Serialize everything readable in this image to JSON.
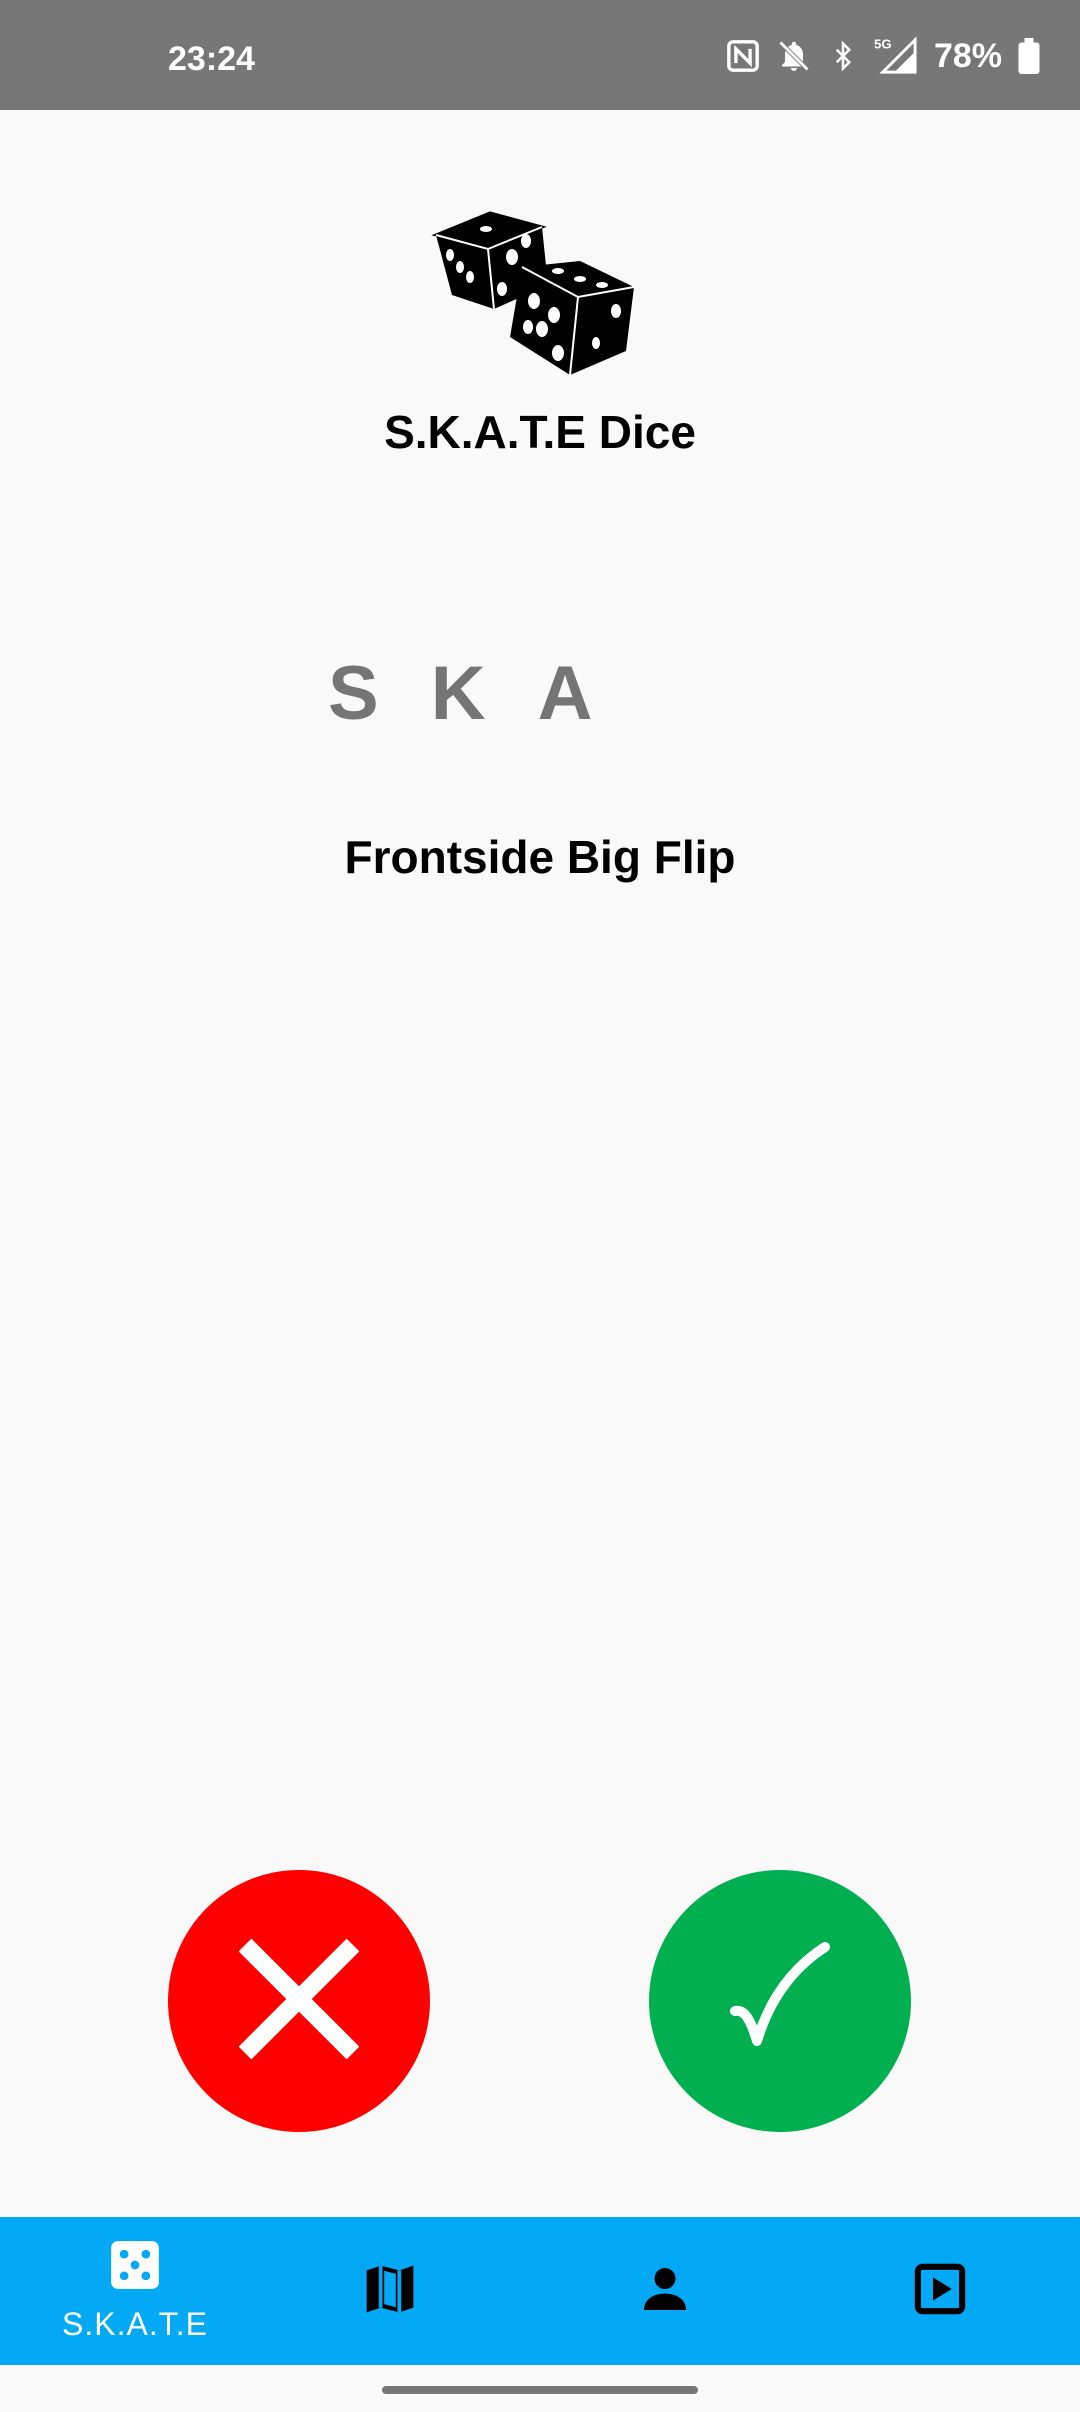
{
  "status_bar": {
    "time": "23:24",
    "battery": "78%",
    "network": "5G",
    "icons": [
      "nfc-icon",
      "bell-off-icon",
      "bluetooth-icon",
      "signal-icon",
      "battery-icon"
    ]
  },
  "header": {
    "logo_icon": "dice-icon",
    "title": "S.K.A.T.E Dice"
  },
  "game": {
    "letters": [
      "S",
      "K",
      "A"
    ],
    "trick": "Frontside Big Flip"
  },
  "actions": {
    "fail_icon": "close-icon",
    "land_icon": "checkmark-icon",
    "fail_color": "#ff0000",
    "land_color": "#00b050"
  },
  "bottom_nav": {
    "color": "#03a9f4",
    "items": [
      {
        "icon": "dice-five-icon",
        "label": "S.K.A.T.E",
        "active": true
      },
      {
        "icon": "map-icon",
        "label": ""
      },
      {
        "icon": "person-icon",
        "label": ""
      },
      {
        "icon": "play-box-icon",
        "label": ""
      }
    ]
  }
}
